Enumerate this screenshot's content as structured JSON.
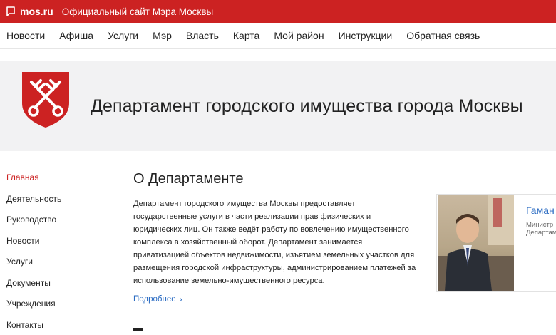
{
  "topbar": {
    "site": "mos.ru",
    "subtitle": "Официальный сайт Мэра Москвы",
    "icon": "mos-logo-icon"
  },
  "nav": {
    "items": [
      "Новости",
      "Афиша",
      "Услуги",
      "Мэр",
      "Власть",
      "Карта",
      "Мой район",
      "Инструкции",
      "Обратная связь"
    ]
  },
  "hero": {
    "title": "Департамент городского имущества города Москвы",
    "emblem": "crossed-keys-emblem"
  },
  "sidebar": {
    "items": [
      {
        "label": "Главная",
        "active": true
      },
      {
        "label": "Деятельность",
        "active": false
      },
      {
        "label": "Руководство",
        "active": false
      },
      {
        "label": "Новости",
        "active": false
      },
      {
        "label": "Услуги",
        "active": false
      },
      {
        "label": "Документы",
        "active": false
      },
      {
        "label": "Учреждения",
        "active": false
      },
      {
        "label": "Контакты",
        "active": false
      }
    ]
  },
  "about": {
    "heading": "О Департаменте",
    "lines": [
      "Департамент городского имущества Москвы предоставляет",
      "государственные услуги в части реализации прав физических и",
      "юридических лиц. Он также ведёт работу по вовлечению имущественного",
      "комплекса в хозяйственный оборот. Департамент занимается",
      "приватизацией объектов недвижимости, изъятием земельных участков для",
      "размещения городской инфраструктуры, администрированием платежей за",
      "использование земельно-имущественного ресурса."
    ],
    "more_label": "Подробнее"
  },
  "head_card": {
    "name": "Гаман",
    "role_line1": "Министр",
    "role_line2": "Департам"
  },
  "colors": {
    "brand_red": "#cc2222",
    "link_blue": "#2a6bc2",
    "hero_bg": "#f2f2f3"
  }
}
